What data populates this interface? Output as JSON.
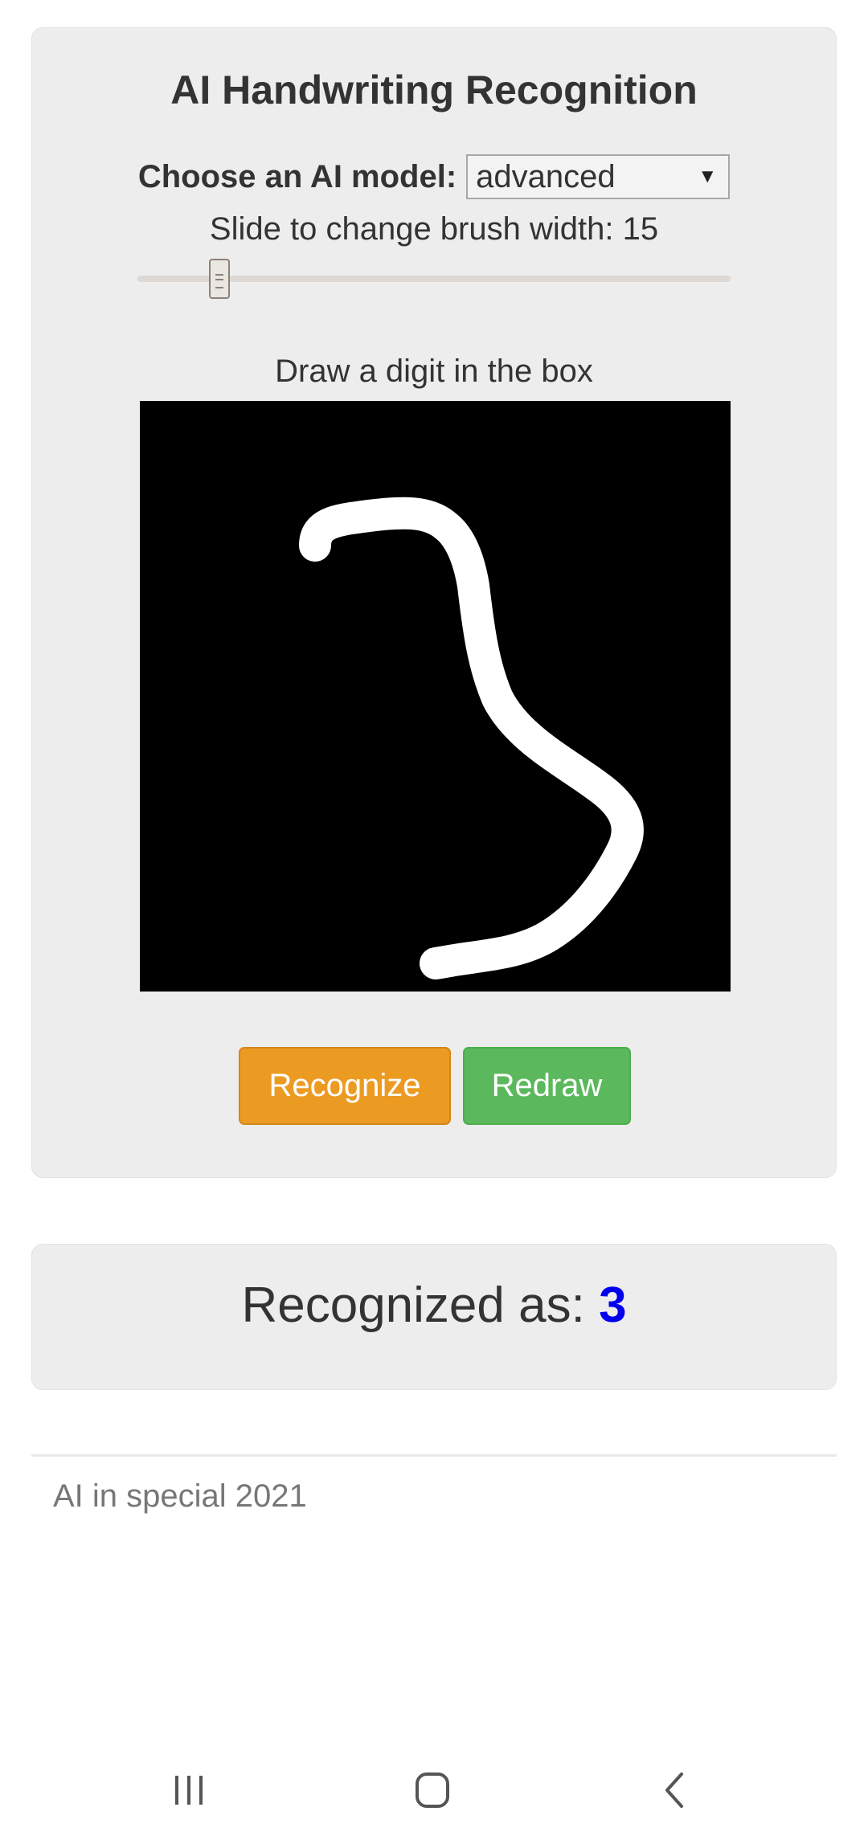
{
  "app": {
    "title": "AI Handwriting Recognition"
  },
  "model": {
    "label": "Choose an AI model:",
    "selected": "advanced"
  },
  "brush": {
    "label": "Slide to change brush width: 15",
    "width": 15
  },
  "canvas": {
    "label": "Draw a digit in the box"
  },
  "buttons": {
    "recognize": "Recognize",
    "redraw": "Redraw"
  },
  "result": {
    "label": "Recognized as: ",
    "value": "3"
  },
  "footer": {
    "text": "AI in special 2021"
  },
  "colors": {
    "panel": "#ededed",
    "recognize": "#ec9b22",
    "redraw": "#5cb85c",
    "result_value": "#0000ee"
  },
  "icons": {
    "nav_recent": "recent-apps-icon",
    "nav_home": "home-icon",
    "nav_back": "back-icon"
  }
}
